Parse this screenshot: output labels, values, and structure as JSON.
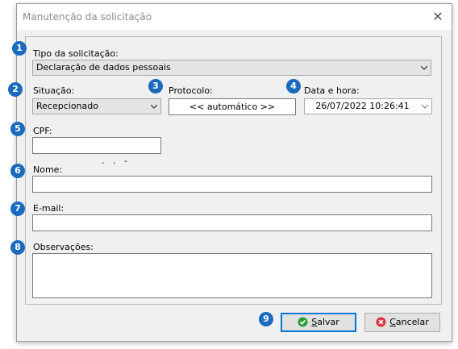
{
  "window": {
    "title": "Manutenção da solicitação"
  },
  "fields": {
    "tipo": {
      "label": "Tipo da solicitação:",
      "value": "Declaração de dados pessoais"
    },
    "situacao": {
      "label": "Situação:",
      "value": "Recepcionado"
    },
    "protocolo": {
      "label": "Protocolo:",
      "value": "<< automático >>"
    },
    "data_hora": {
      "label": "Data e hora:",
      "value": "26/07/2022 10:26:41"
    },
    "cpf": {
      "label": "CPF:",
      "value": ".   .   -"
    },
    "nome": {
      "label": "Nome:",
      "value": ""
    },
    "email": {
      "label": "E-mail:",
      "value": ""
    },
    "observacoes": {
      "label": "Observações:",
      "value": ""
    }
  },
  "badges": [
    "1",
    "2",
    "3",
    "4",
    "5",
    "6",
    "7",
    "8",
    "9"
  ],
  "buttons": {
    "salvar": {
      "first": "S",
      "rest": "alvar",
      "icon": "check-circle-icon",
      "icon_color": "#2e9e3c"
    },
    "cancelar": {
      "first": "C",
      "rest": "ancelar",
      "icon": "x-circle-icon",
      "icon_color": "#d9363e"
    }
  },
  "colors": {
    "badge": "#1a6bc0",
    "default_border": "#0078d7"
  }
}
